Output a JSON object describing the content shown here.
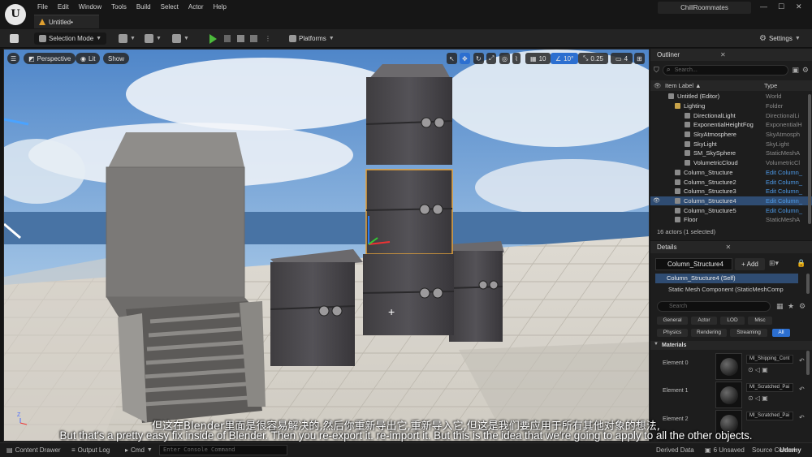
{
  "app": {
    "logo": "U",
    "menu": [
      "File",
      "Edit",
      "Window",
      "Tools",
      "Build",
      "Select",
      "Actor",
      "Help"
    ],
    "doc_tab": "Untitled•",
    "project": "ChillRoommates",
    "window_controls": [
      "—",
      "☐",
      "✕"
    ]
  },
  "toolbar": {
    "selection_mode": "Selection Mode",
    "platforms": "Platforms",
    "settings": "Settings"
  },
  "viewport": {
    "perspective": "Perspective",
    "lit": "Lit",
    "show": "Show",
    "grid_size": "10",
    "rot_snap": "10°",
    "scale_snap": "0.25",
    "camera_speed": "4"
  },
  "outliner": {
    "tab": "Outliner",
    "search_placeholder": "Search...",
    "col_label": "Item Label ▲",
    "col_type": "Type",
    "rows": [
      {
        "name": "Untitled (Editor)",
        "type": "World",
        "indent": 1,
        "icon": "world",
        "link": false,
        "selected": false
      },
      {
        "name": "Lighting",
        "type": "Folder",
        "indent": 2,
        "icon": "folder",
        "link": false,
        "selected": false
      },
      {
        "name": "DirectionalLight",
        "type": "DirectionalLi",
        "indent": 3,
        "icon": "light",
        "link": false,
        "selected": false
      },
      {
        "name": "ExponentialHeightFog",
        "type": "ExponentialH",
        "indent": 3,
        "icon": "fog",
        "link": false,
        "selected": false
      },
      {
        "name": "SkyAtmosphere",
        "type": "SkyAtmosph",
        "indent": 3,
        "icon": "sky",
        "link": false,
        "selected": false
      },
      {
        "name": "SkyLight",
        "type": "SkyLight",
        "indent": 3,
        "icon": "light",
        "link": false,
        "selected": false
      },
      {
        "name": "SM_SkySphere",
        "type": "StaticMeshA",
        "indent": 3,
        "icon": "mesh",
        "link": false,
        "selected": false
      },
      {
        "name": "VolumetricCloud",
        "type": "VolumetricCl",
        "indent": 3,
        "icon": "cloud",
        "link": false,
        "selected": false
      },
      {
        "name": "Column_Structure",
        "type": "Edit Column_",
        "indent": 2,
        "icon": "mesh",
        "link": true,
        "selected": false
      },
      {
        "name": "Column_Structure2",
        "type": "Edit Column_",
        "indent": 2,
        "icon": "mesh",
        "link": true,
        "selected": false
      },
      {
        "name": "Column_Structure3",
        "type": "Edit Column_",
        "indent": 2,
        "icon": "mesh",
        "link": true,
        "selected": false
      },
      {
        "name": "Column_Structure4",
        "type": "Edit Column_",
        "indent": 2,
        "icon": "mesh",
        "link": true,
        "selected": true
      },
      {
        "name": "Column_Structure5",
        "type": "Edit Column_",
        "indent": 2,
        "icon": "mesh",
        "link": true,
        "selected": false
      },
      {
        "name": "Floor",
        "type": "StaticMeshA",
        "indent": 2,
        "icon": "mesh",
        "link": false,
        "selected": false
      }
    ],
    "footer": "16 actors (1 selected)"
  },
  "details": {
    "tab": "Details",
    "actor_name": "Column_Structure4",
    "add_label": "+ Add",
    "self_row": "Column_Structure4 (Self)",
    "component_row": "Static Mesh Component (StaticMeshComp",
    "search_placeholder": "Search",
    "filters_row1": [
      "General",
      "Actor",
      "LOD",
      "Misc"
    ],
    "filters_row2": [
      "Physics",
      "Rendering",
      "Streaming",
      "All"
    ],
    "materials_header": "Materials",
    "elements": [
      {
        "label": "Element 0",
        "material": "MI_Shipping_Cont"
      },
      {
        "label": "Element 1",
        "material": "MI_Scratched_Pai"
      },
      {
        "label": "Element 2",
        "material": "MI_Scratched_Pai"
      }
    ]
  },
  "bottombar": {
    "content_drawer": "Content Drawer",
    "output_log": "Output Log",
    "cmd": "Cmd",
    "console_placeholder": "Enter Console Command",
    "derived_data": "Derived Data",
    "unsaved": "6 Unsaved",
    "source_control": "Source Control",
    "watermark": "Udemy"
  },
  "subtitles": {
    "cn": "但这在Blender里面是很容易解决的,然后你重新导出它,重新导入它,但这是我们要应用于所有其他对象的想法,",
    "en": "But that's a pretty easy fix inside of Blender. Then you re-export it. re-import it. But this is the idea that we're going to apply to all the other objects."
  }
}
